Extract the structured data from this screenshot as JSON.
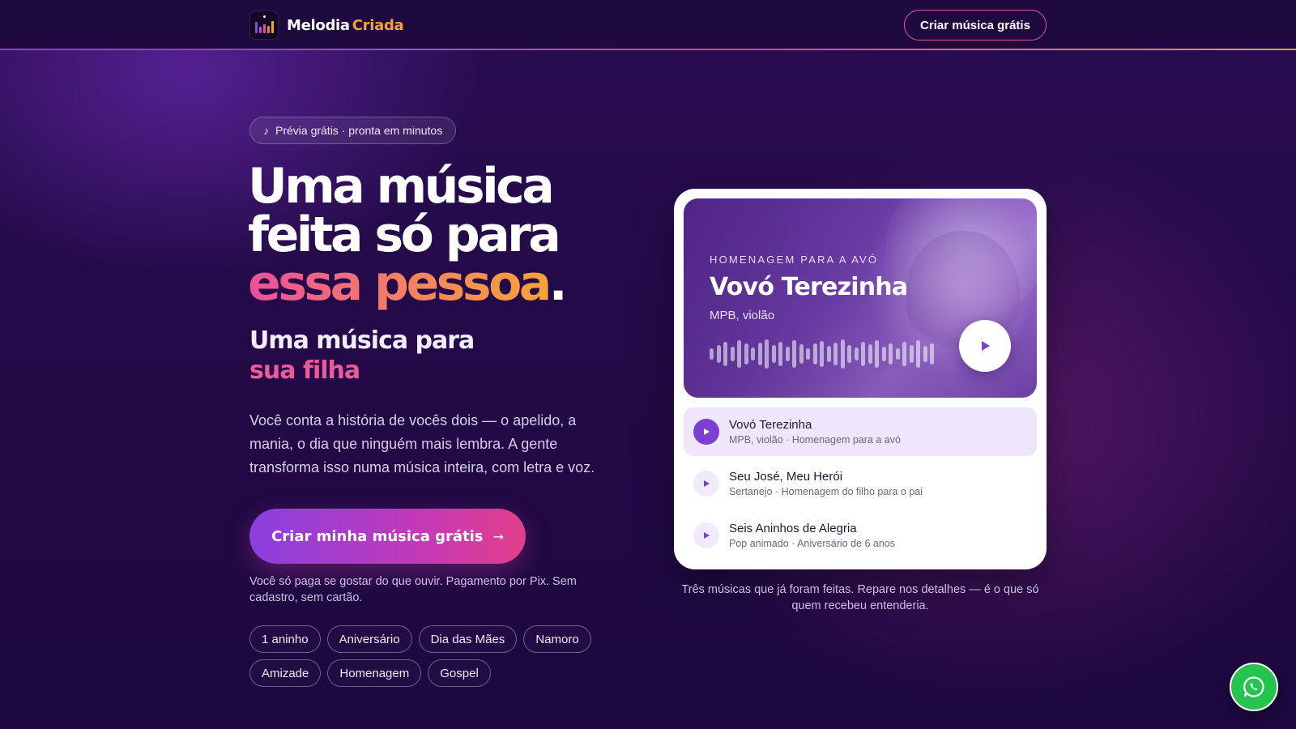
{
  "header": {
    "brand_part1": "Melodia",
    "brand_part2": "Criada",
    "cta_label": "Criar música grátis"
  },
  "hero": {
    "badge_icon": "♪",
    "badge_text": "Prévia grátis · pronta em minutos",
    "headline_line1": "Uma música",
    "headline_line2": "feita só para",
    "headline_accent": "essa pessoa",
    "headline_period": ".",
    "subhead_line1": "Uma música para",
    "subhead_accent": "sua filha",
    "description": "Você conta a história de vocês dois — o apelido, a mania, o dia que ninguém mais lembra. A gente transforma isso numa música inteira, com letra e voz.",
    "cta_label": "Criar minha música grátis",
    "cta_arrow": "→",
    "note": "Você só paga se gostar do que ouvir. Pagamento por Pix. Sem cadastro, sem cartão.",
    "tags": [
      "1 aninho",
      "Aniversário",
      "Dia das Mães",
      "Namoro",
      "Amizade",
      "Homenagem",
      "Gospel"
    ]
  },
  "player": {
    "featured": {
      "overline": "Homenagem para a avó",
      "title": "Vovó Terezinha",
      "genre": "MPB, violão"
    },
    "tracks": [
      {
        "name": "Vovó Terezinha",
        "meta": "MPB, violão · Homenagem para a avó"
      },
      {
        "name": "Seu José, Meu Herói",
        "meta": "Sertanejo · Homenagem do filho para o pai"
      },
      {
        "name": "Seis Aninhos de Alegria",
        "meta": "Pop animado · Aniversário de 6 anos"
      }
    ],
    "caption": "Três músicas que já foram feitas. Repare nos detalhes — é o que só quem recebeu entenderia."
  },
  "colors": {
    "accent_purple": "#7b3fd6",
    "accent_pink": "#ec4f9c",
    "accent_orange": "#f5a33a",
    "whatsapp_green": "#27c34f"
  },
  "icons": {
    "brand": "music-bars-icon",
    "play": "play-icon",
    "whatsapp": "whatsapp-icon"
  }
}
